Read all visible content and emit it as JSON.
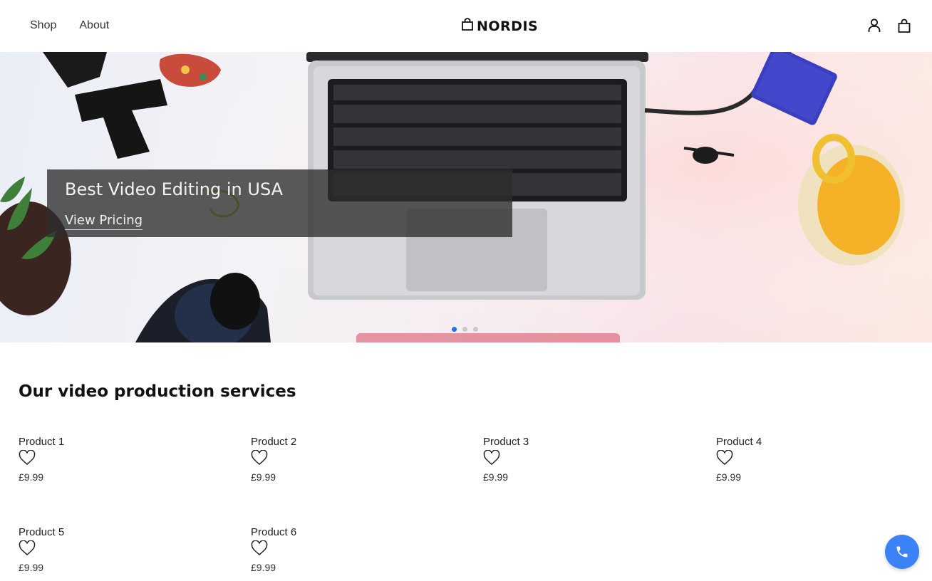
{
  "header": {
    "nav": [
      {
        "label": "Shop"
      },
      {
        "label": "About"
      }
    ],
    "logo_text": "NORDIS",
    "icons": [
      "user-icon",
      "bag-icon"
    ]
  },
  "hero": {
    "title": "Best Video Editing in USA",
    "link_label": "View Pricing",
    "slides_count": 3,
    "active_slide": 1
  },
  "section": {
    "title": "Our video production services"
  },
  "products": [
    {
      "name": "Product 1",
      "price": "£9.99"
    },
    {
      "name": "Product 2",
      "price": "£9.99"
    },
    {
      "name": "Product 3",
      "price": "£9.99"
    },
    {
      "name": "Product 4",
      "price": "£9.99"
    },
    {
      "name": "Product 5",
      "price": "£9.99"
    },
    {
      "name": "Product 6",
      "price": "£9.99"
    }
  ],
  "colors": {
    "accent": "#1a73e8",
    "call_button": "#3b82f6"
  }
}
